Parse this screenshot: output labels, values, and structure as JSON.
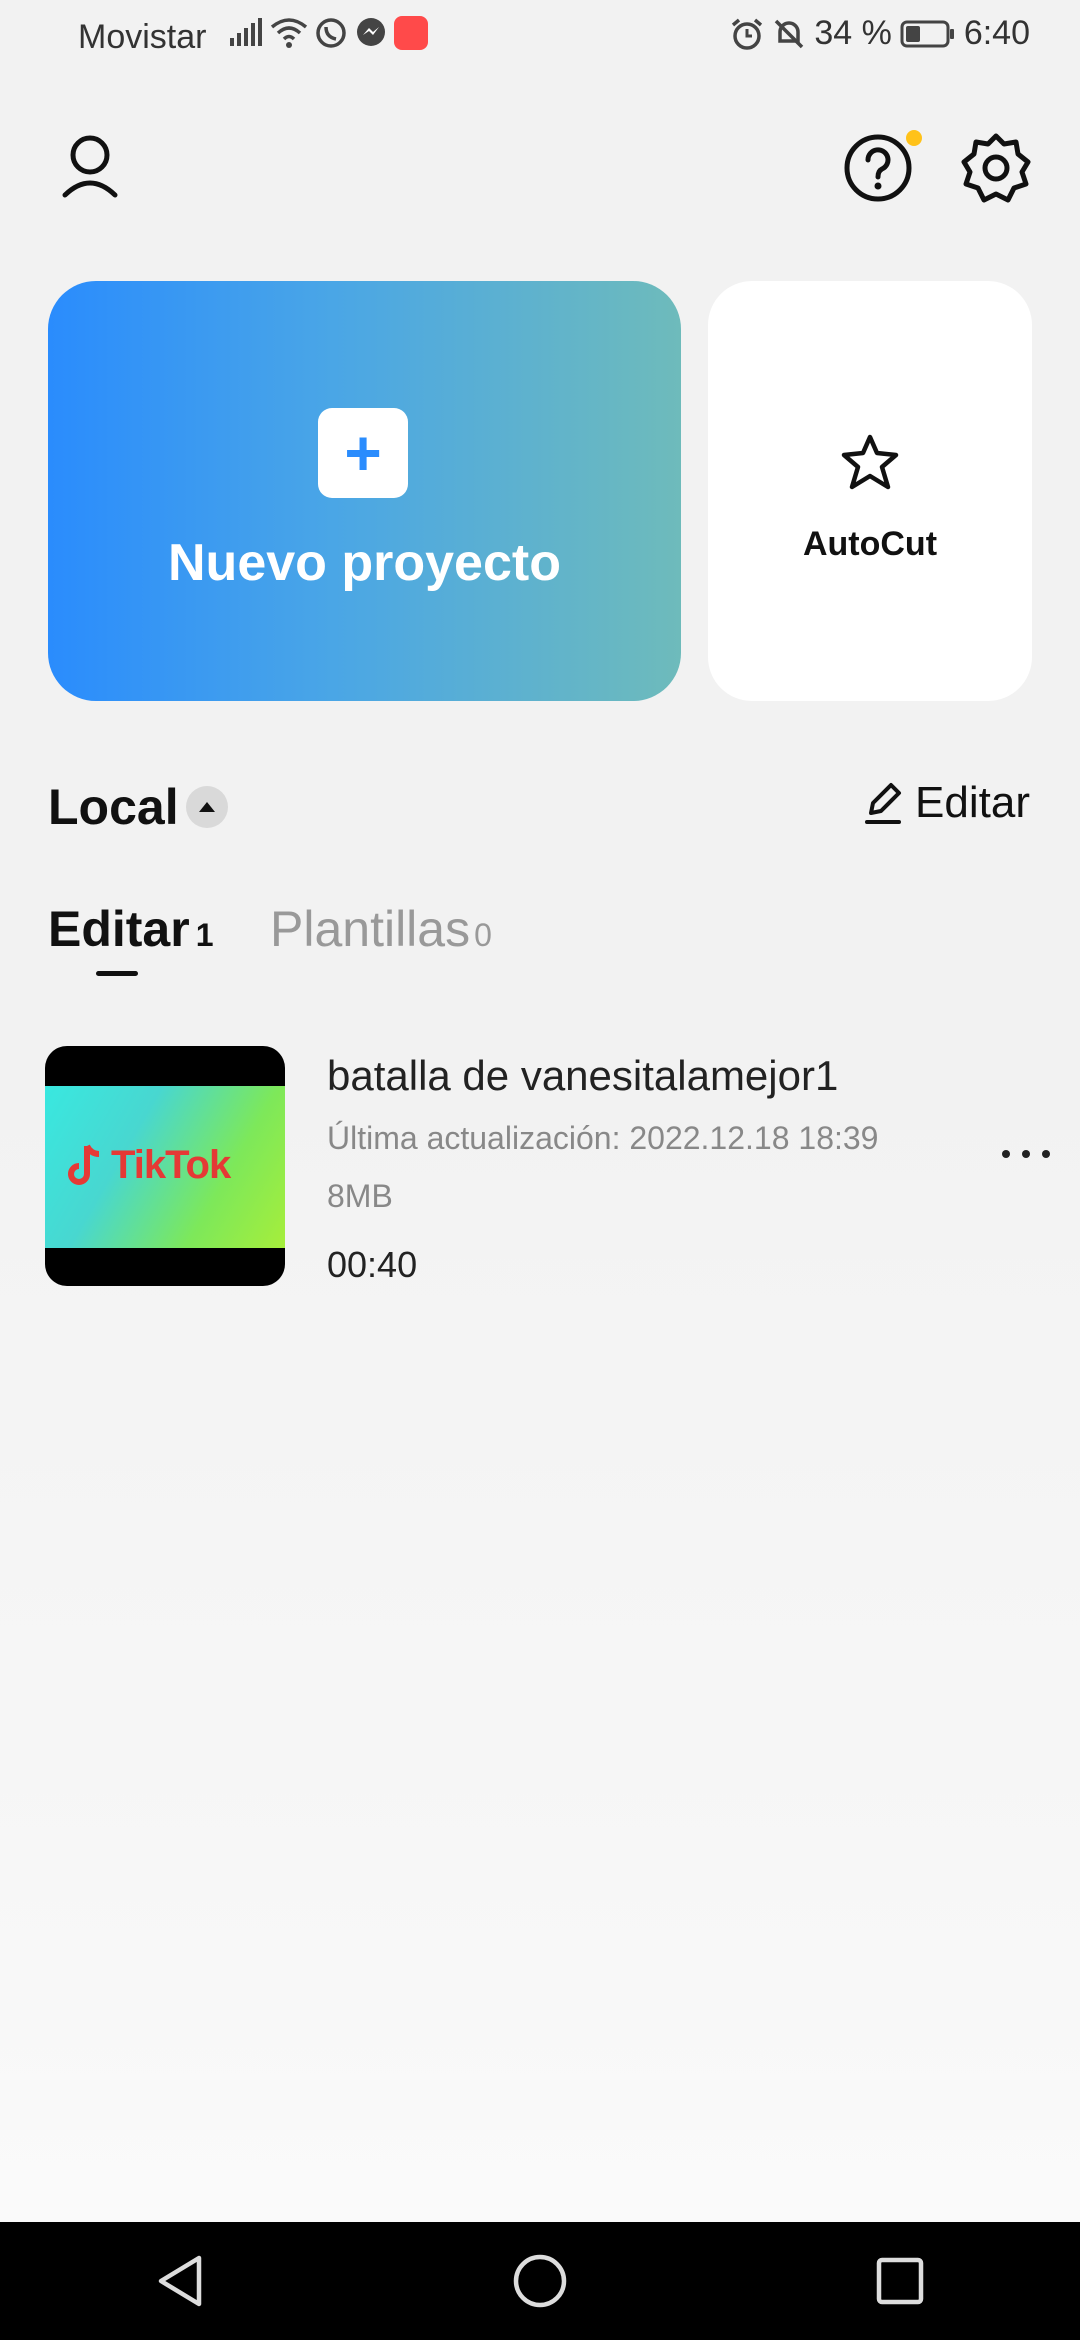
{
  "status_bar": {
    "carrier": "Movistar",
    "battery": "34 %",
    "time": "6:40"
  },
  "header": {
    "icons": [
      "profile-icon",
      "help-icon",
      "settings-icon"
    ],
    "help_badge_color": "#ffc21a"
  },
  "cards": {
    "new_project_label": "Nuevo proyecto",
    "new_project_icon": "+",
    "autocut_label": "AutoCut"
  },
  "local": {
    "title": "Local",
    "edit_label": "Editar"
  },
  "tabs": [
    {
      "label": "Editar",
      "count": "1"
    },
    {
      "label": "Plantillas",
      "count": "0"
    }
  ],
  "projects": [
    {
      "title": "batalla de vanesitalamejor1",
      "updated": "Última actualización: 2022.12.18 18:39",
      "size": "8MB",
      "duration": "00:40",
      "thumb_logo_text": "TikTok"
    }
  ],
  "colors": {
    "accent_blue": "#2a8cfd",
    "accent_teal": "#6ebbbb"
  }
}
